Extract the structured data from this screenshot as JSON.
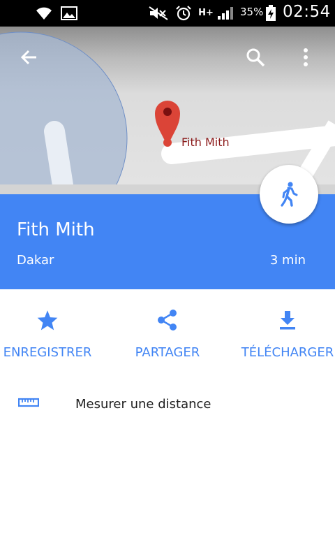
{
  "status_bar": {
    "battery_percent": "35%",
    "time": "02:54",
    "network_label": "H+",
    "icons": [
      "wifi-icon",
      "photo-icon",
      "mute-icon",
      "alarm-icon",
      "network-type-icon",
      "signal-icon",
      "battery-charging-icon"
    ]
  },
  "map": {
    "place_label": "Fith Mith",
    "icons": [
      "back-arrow-icon",
      "search-icon",
      "more-vert-icon",
      "map-pin-icon"
    ]
  },
  "place": {
    "title": "Fith Mith",
    "subtitle": "Dakar",
    "travel_time": "3 min",
    "fab_icon": "walking-icon"
  },
  "actions": [
    {
      "label": "ENREGISTRER",
      "icon": "star-icon"
    },
    {
      "label": "PARTAGER",
      "icon": "share-icon"
    },
    {
      "label": "TÉLÉCHARGER",
      "icon": "download-icon"
    }
  ],
  "measure": {
    "label": "Mesurer une distance",
    "icon": "ruler-icon"
  },
  "colors": {
    "accent": "#4285f4",
    "pin": "#db4437",
    "map_label": "#8b1a1a"
  }
}
